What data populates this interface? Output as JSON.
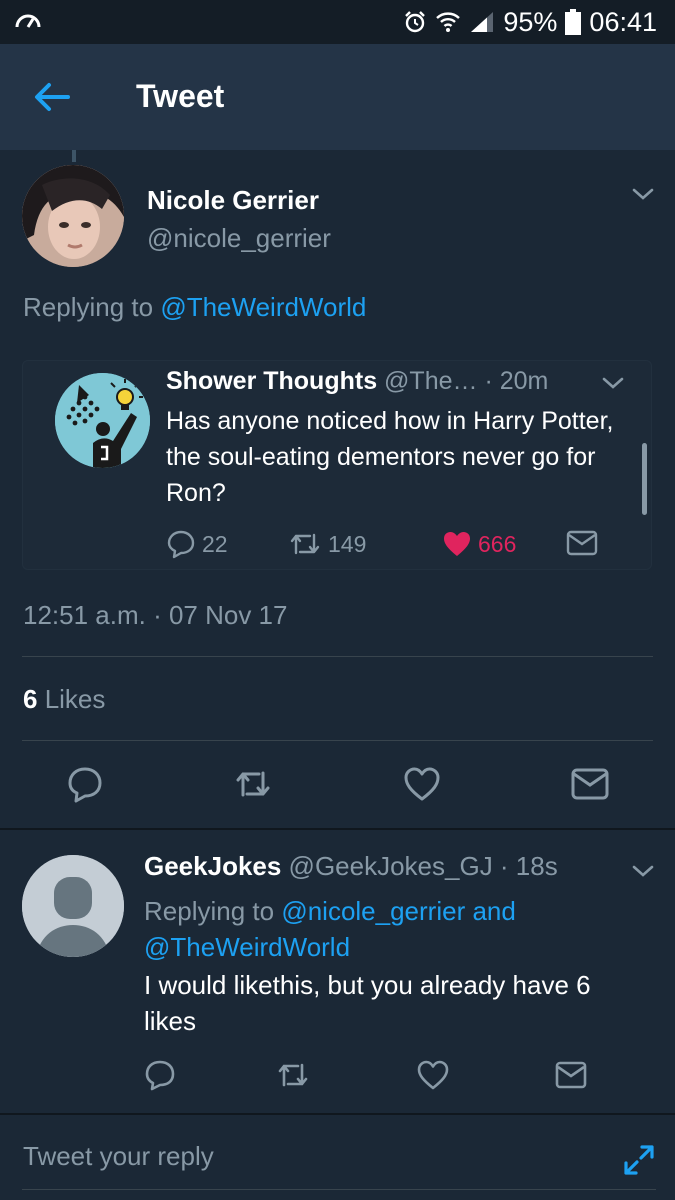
{
  "status_bar": {
    "battery": "95%",
    "time": "06:41"
  },
  "app_bar": {
    "title": "Tweet"
  },
  "tweet": {
    "author_name": "Nicole Gerrier",
    "author_handle": "@nicole_gerrier",
    "replying_prefix": "Replying to",
    "replying_to": "@TheWeirdWorld",
    "timestamp": "12:51 a.m. · 07 Nov 17",
    "likes_count": "6",
    "likes_label": " Likes"
  },
  "quoted_tweet": {
    "name": "Shower Thoughts",
    "handle_time": " @The… · 20m",
    "text": "Has anyone noticed how in Harry Potter, the soul-eating dementors never go for Ron?",
    "replies": "22",
    "retweets": "149",
    "likes": "666"
  },
  "reply": {
    "name": "GeekJokes",
    "handle_time": " @GeekJokes_GJ · 18s",
    "replying_prefix": "Replying to ",
    "replying_to": "@nicole_gerrier and @TheWeirdWorld",
    "text": "I would likethis, but you already have 6 likes"
  },
  "composer": {
    "placeholder": "Tweet your reply"
  },
  "colors": {
    "accent": "#1da1f2",
    "like": "#e0245e",
    "muted": "#8899a6",
    "background": "#1b2836"
  }
}
